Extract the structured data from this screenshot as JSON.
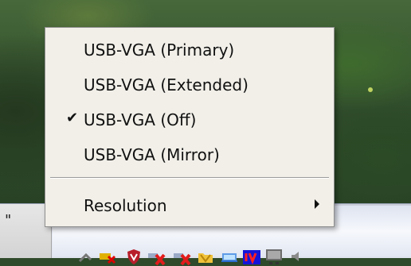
{
  "menu": {
    "items": [
      {
        "label": "USB-VGA (Primary)",
        "checked": false
      },
      {
        "label": "USB-VGA (Extended)",
        "checked": false
      },
      {
        "label": "USB-VGA (Off)",
        "checked": true
      },
      {
        "label": "USB-VGA (Mirror)",
        "checked": false
      }
    ],
    "submenu": {
      "label": "Resolution"
    },
    "check_glyph": "✔"
  },
  "taskbar": {
    "left_glyph": "\"",
    "tray_icons": [
      "network-tools-icon",
      "disconnected-network-icon",
      "shield-security-icon",
      "network-connection-x-icon",
      "network-connection-x-icon",
      "folder-network-icon",
      "network-monitor-icon",
      "usb-vga-icon",
      "monitor-display-icon",
      "speaker-icon"
    ]
  },
  "colors": {
    "menu_background": "#f1efe8",
    "taskbar_background": "#e2e7f2",
    "desktop_green": "#2f4a2a"
  }
}
